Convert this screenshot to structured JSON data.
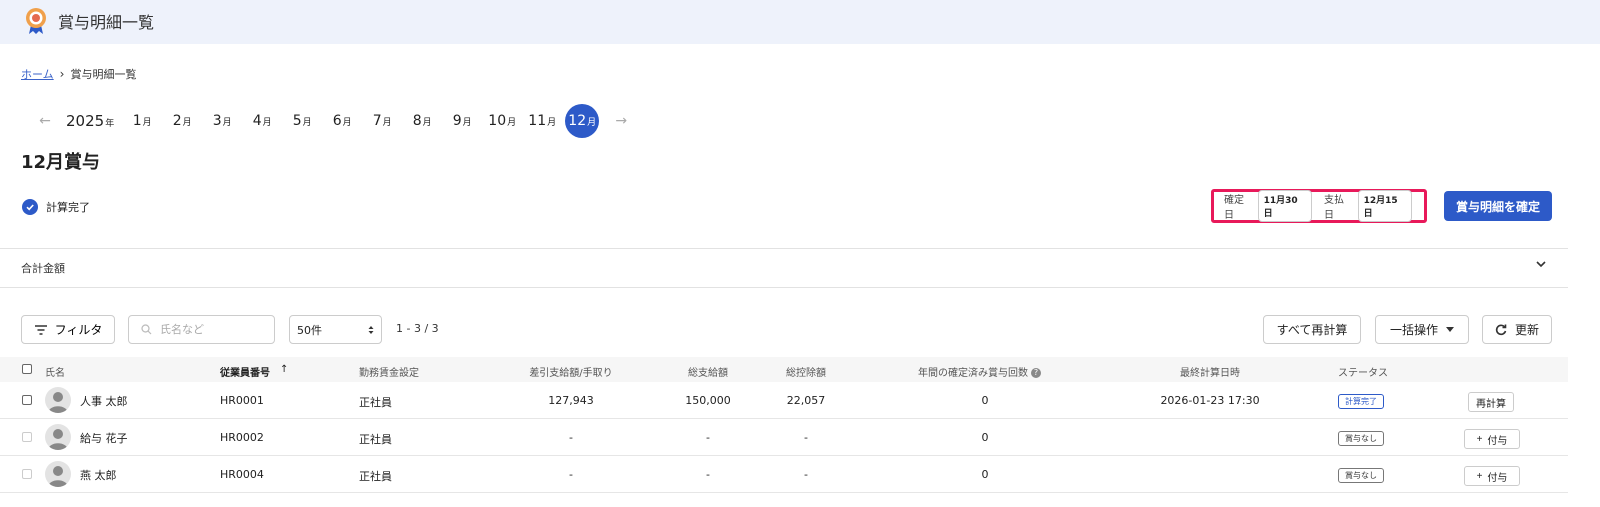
{
  "app": {
    "title": "賞与明細一覧"
  },
  "breadcrumb": {
    "home": "ホーム",
    "separator": "›",
    "current": "賞与明細一覧"
  },
  "month_nav": {
    "prev": "←",
    "next": "→",
    "year": "2025",
    "year_unit": "年",
    "month_unit": "月",
    "months": [
      "1",
      "2",
      "3",
      "4",
      "5",
      "6",
      "7",
      "8",
      "9",
      "10",
      "11",
      "12"
    ],
    "active_month": "12"
  },
  "section": {
    "title": "12月賞与"
  },
  "status": {
    "label": "計算完了"
  },
  "dates": {
    "confirm_label": "確定日",
    "confirm_value": "11月30日",
    "pay_label": "支払日",
    "pay_value": "12月15日"
  },
  "confirm_button": "賞与明細を確定",
  "totals": {
    "label": "合計金額"
  },
  "toolbar": {
    "filter": "フィルタ",
    "search_placeholder": "氏名など",
    "per_page": "50件",
    "range": "1 - 3 / 3",
    "recalc_all": "すべて再計算",
    "bulk": "一括操作",
    "refresh": "更新"
  },
  "table": {
    "columns": {
      "name": "氏名",
      "employee_no": "従業員番号",
      "pay_setting": "勤務賃金設定",
      "net": "差引支給額/手取り",
      "gross": "総支給額",
      "deduction": "総控除額",
      "count": "年間の確定済み賞与回数",
      "last_calc": "最終計算日時",
      "status": "ステータス"
    },
    "sort_indicator": "↑",
    "rows": [
      {
        "name": "人事 太郎",
        "employee_no": "HR0001",
        "pay_setting": "正社員",
        "net": "127,943",
        "gross": "150,000",
        "deduction": "22,057",
        "count": "0",
        "last_calc": "2026-01-23 17:30",
        "status": "計算完了",
        "action": "再計算"
      },
      {
        "name": "給与 花子",
        "employee_no": "HR0002",
        "pay_setting": "正社員",
        "net": "-",
        "gross": "-",
        "deduction": "-",
        "count": "0",
        "last_calc": "",
        "status": "賞与なし",
        "action": "付与"
      },
      {
        "name": "燕 太郎",
        "employee_no": "HR0004",
        "pay_setting": "正社員",
        "net": "-",
        "gross": "-",
        "deduction": "-",
        "count": "0",
        "last_calc": "",
        "status": "賞与なし",
        "action": "付与"
      }
    ]
  },
  "colors": {
    "primary": "#2d5ac8",
    "highlight": "#e8195a",
    "header_bg": "#eef2fb"
  },
  "icons": {
    "logo": "award-badge-icon",
    "check": "check-circle-icon",
    "filter": "filter-lines-icon",
    "search": "search-icon",
    "refresh": "refresh-icon",
    "help": "help-circle-icon",
    "expand": "chevron-down-icon",
    "avatar": "user-silhouette-icon",
    "add": "plus-icon"
  }
}
